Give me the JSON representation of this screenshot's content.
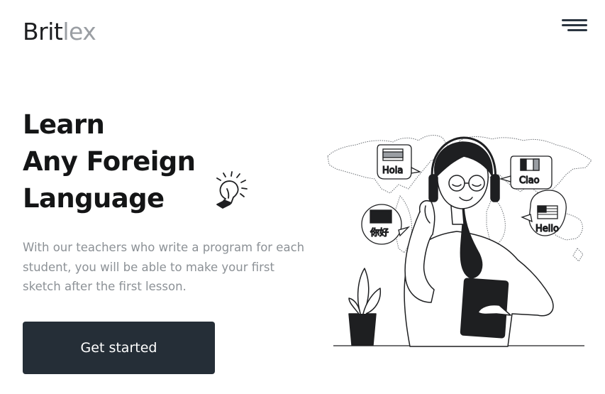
{
  "header": {
    "logo_dark": "Brit",
    "logo_light": "lex",
    "menu_icon": "hamburger-menu-icon"
  },
  "hero": {
    "title_lines": [
      "Learn",
      "Any Foreign",
      "Language"
    ],
    "description": "With our teachers who write a program for each student, you will be able to make your first sketch after the first lesson.",
    "cta_label": "Get started",
    "bulb_icon": "lightbulb-icon"
  },
  "illustration": {
    "bubbles": [
      {
        "text": "Hola",
        "flag": "spain-flag-icon"
      },
      {
        "text": "Ciao",
        "flag": "italy-flag-icon"
      },
      {
        "text": "你好",
        "flag": "china-flag-icon"
      },
      {
        "text": "Hello",
        "flag": "usa-flag-icon"
      }
    ]
  },
  "colors": {
    "text_dark": "#141516",
    "text_muted": "#8c9196",
    "button_bg": "#252e37",
    "button_text": "#ffffff",
    "logo_accent": "#9a9ea3"
  }
}
